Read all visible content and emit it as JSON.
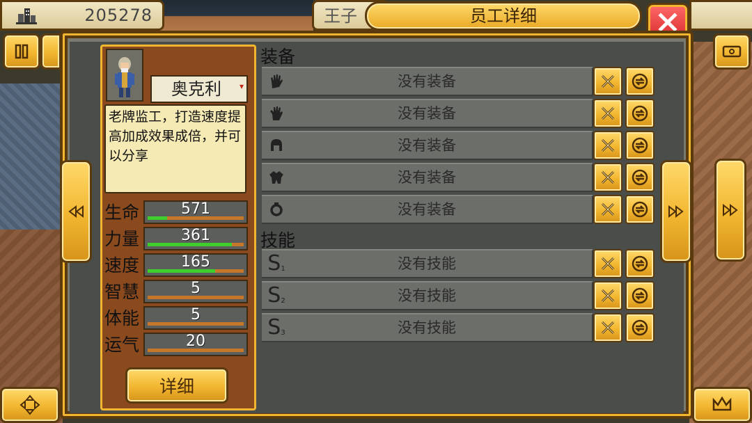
{
  "money": {
    "value": "205278",
    "icon": "building-icon"
  },
  "top": {
    "name_tab": "王子",
    "title": "员工详细",
    "close_icon": "close-icon"
  },
  "character": {
    "name": "奥克利",
    "description": "老牌监工，打造速度提高加成效果成倍，并可以分享",
    "stats": [
      {
        "label": "生命",
        "value": "571",
        "fill": 0.2
      },
      {
        "label": "力量",
        "value": "361",
        "fill": 0.88
      },
      {
        "label": "速度",
        "value": "165",
        "fill": 0.7
      },
      {
        "label": "智慧",
        "value": "5",
        "fill": 0
      },
      {
        "label": "体能",
        "value": "5",
        "fill": 0
      },
      {
        "label": "运气",
        "value": "20",
        "fill": 0
      }
    ],
    "detail_button": "详细"
  },
  "equipment": {
    "title": "装备",
    "slots": [
      {
        "icon": "hand-icon",
        "text": "没有装备"
      },
      {
        "icon": "glove-icon",
        "text": "没有装备"
      },
      {
        "icon": "helmet-icon",
        "text": "没有装备"
      },
      {
        "icon": "armor-icon",
        "text": "没有装备"
      },
      {
        "icon": "ring-icon",
        "text": "没有装备"
      }
    ]
  },
  "skills": {
    "title": "技能",
    "slots": [
      {
        "icon": "skill-1-icon",
        "text": "没有技能",
        "index": "1"
      },
      {
        "icon": "skill-2-icon",
        "text": "没有技能",
        "index": "2"
      },
      {
        "icon": "skill-3-icon",
        "text": "没有技能",
        "index": "3"
      }
    ]
  }
}
